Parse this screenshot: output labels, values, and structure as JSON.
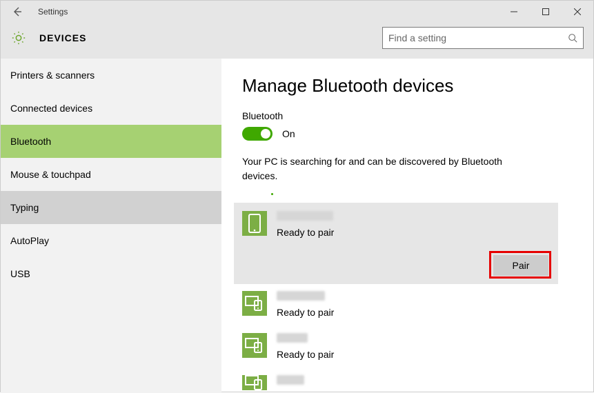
{
  "window": {
    "title": "Settings"
  },
  "header": {
    "category": "DEVICES",
    "search_placeholder": "Find a setting"
  },
  "sidebar": {
    "items": [
      {
        "label": "Printers & scanners",
        "state": ""
      },
      {
        "label": "Connected devices",
        "state": ""
      },
      {
        "label": "Bluetooth",
        "state": "selected"
      },
      {
        "label": "Mouse & touchpad",
        "state": ""
      },
      {
        "label": "Typing",
        "state": "hover"
      },
      {
        "label": "AutoPlay",
        "state": ""
      },
      {
        "label": "USB",
        "state": ""
      }
    ]
  },
  "content": {
    "heading": "Manage Bluetooth devices",
    "toggle_label": "Bluetooth",
    "toggle_state": "On",
    "status_text": "Your PC is searching for and can be discovered by Bluetooth devices.",
    "pair_button": "Pair",
    "devices": [
      {
        "status": "Ready to pair",
        "selected": true,
        "icon": "phone"
      },
      {
        "status": "Ready to pair",
        "selected": false,
        "icon": "devices"
      },
      {
        "status": "Ready to pair",
        "selected": false,
        "icon": "devices"
      },
      {
        "status": "",
        "selected": false,
        "icon": "devices"
      }
    ]
  }
}
